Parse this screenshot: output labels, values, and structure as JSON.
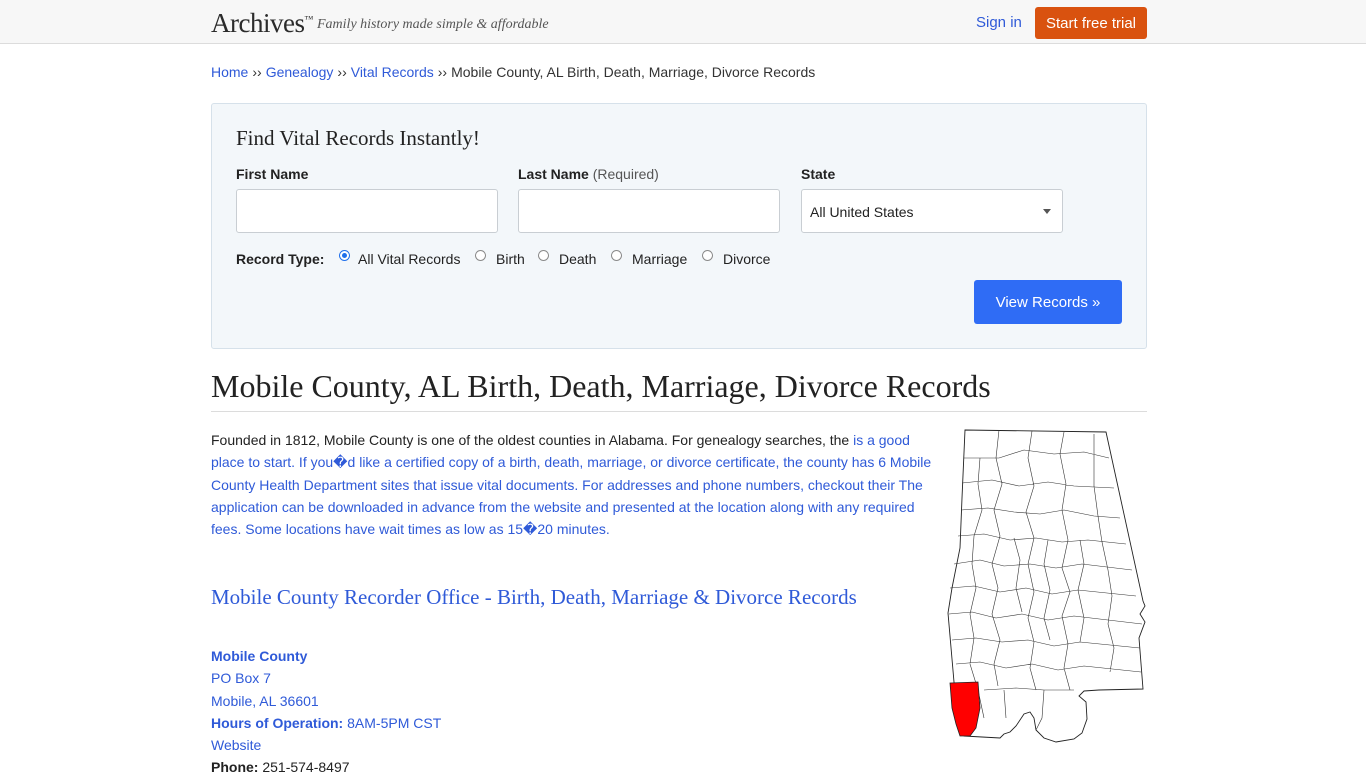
{
  "header": {
    "logo": "Archives",
    "logo_tm": "™",
    "tagline": "Family history made simple & affordable",
    "signin": "Sign in",
    "trial": "Start free trial"
  },
  "breadcrumb": {
    "items": [
      "Home",
      "Genealogy",
      "Vital Records"
    ],
    "separator": "››",
    "current": "Mobile County, AL Birth, Death, Marriage, Divorce Records"
  },
  "search": {
    "title": "Find Vital Records Instantly!",
    "first_name_label": "First Name",
    "last_name_label": "Last Name",
    "last_name_req": "(Required)",
    "state_label": "State",
    "first_name_value": "",
    "last_name_value": "",
    "state_value": "All United States",
    "record_type_label": "Record Type:",
    "record_types": [
      "All Vital Records",
      "Birth",
      "Death",
      "Marriage",
      "Divorce"
    ],
    "selected_record_type": "All Vital Records",
    "button": "View Records »"
  },
  "main": {
    "title": "Mobile County, AL Birth, Death, Marriage, Divorce Records",
    "intro_plain": "Founded in 1812, Mobile County is one of the oldest counties in Alabama. For genealogy searches, the ",
    "intro_link": "is a good place to start. If you�d like a certified copy of a birth, death, marriage, or divorce certificate, the county has 6 Mobile County Health Department sites that issue vital documents. For addresses and phone numbers, checkout their The application can be downloaded in advance from the website and presented at the location along with any required fees. Some locations have wait times as low as 15�20 minutes.",
    "section_heading": "Mobile County Recorder Office - Birth, Death, Marriage & Divorce Records"
  },
  "office": {
    "name": "Mobile County",
    "address1": "PO Box 7",
    "address2": "Mobile, AL 36601",
    "hours_label": "Hours of Operation:",
    "hours": "8AM-5PM CST",
    "website": "Website",
    "phone_label": "Phone:",
    "phone": "251-574-8497"
  },
  "map": {
    "state_fill": "#ffffff",
    "highlight_fill": "#ff0000",
    "border_color": "#222222"
  }
}
